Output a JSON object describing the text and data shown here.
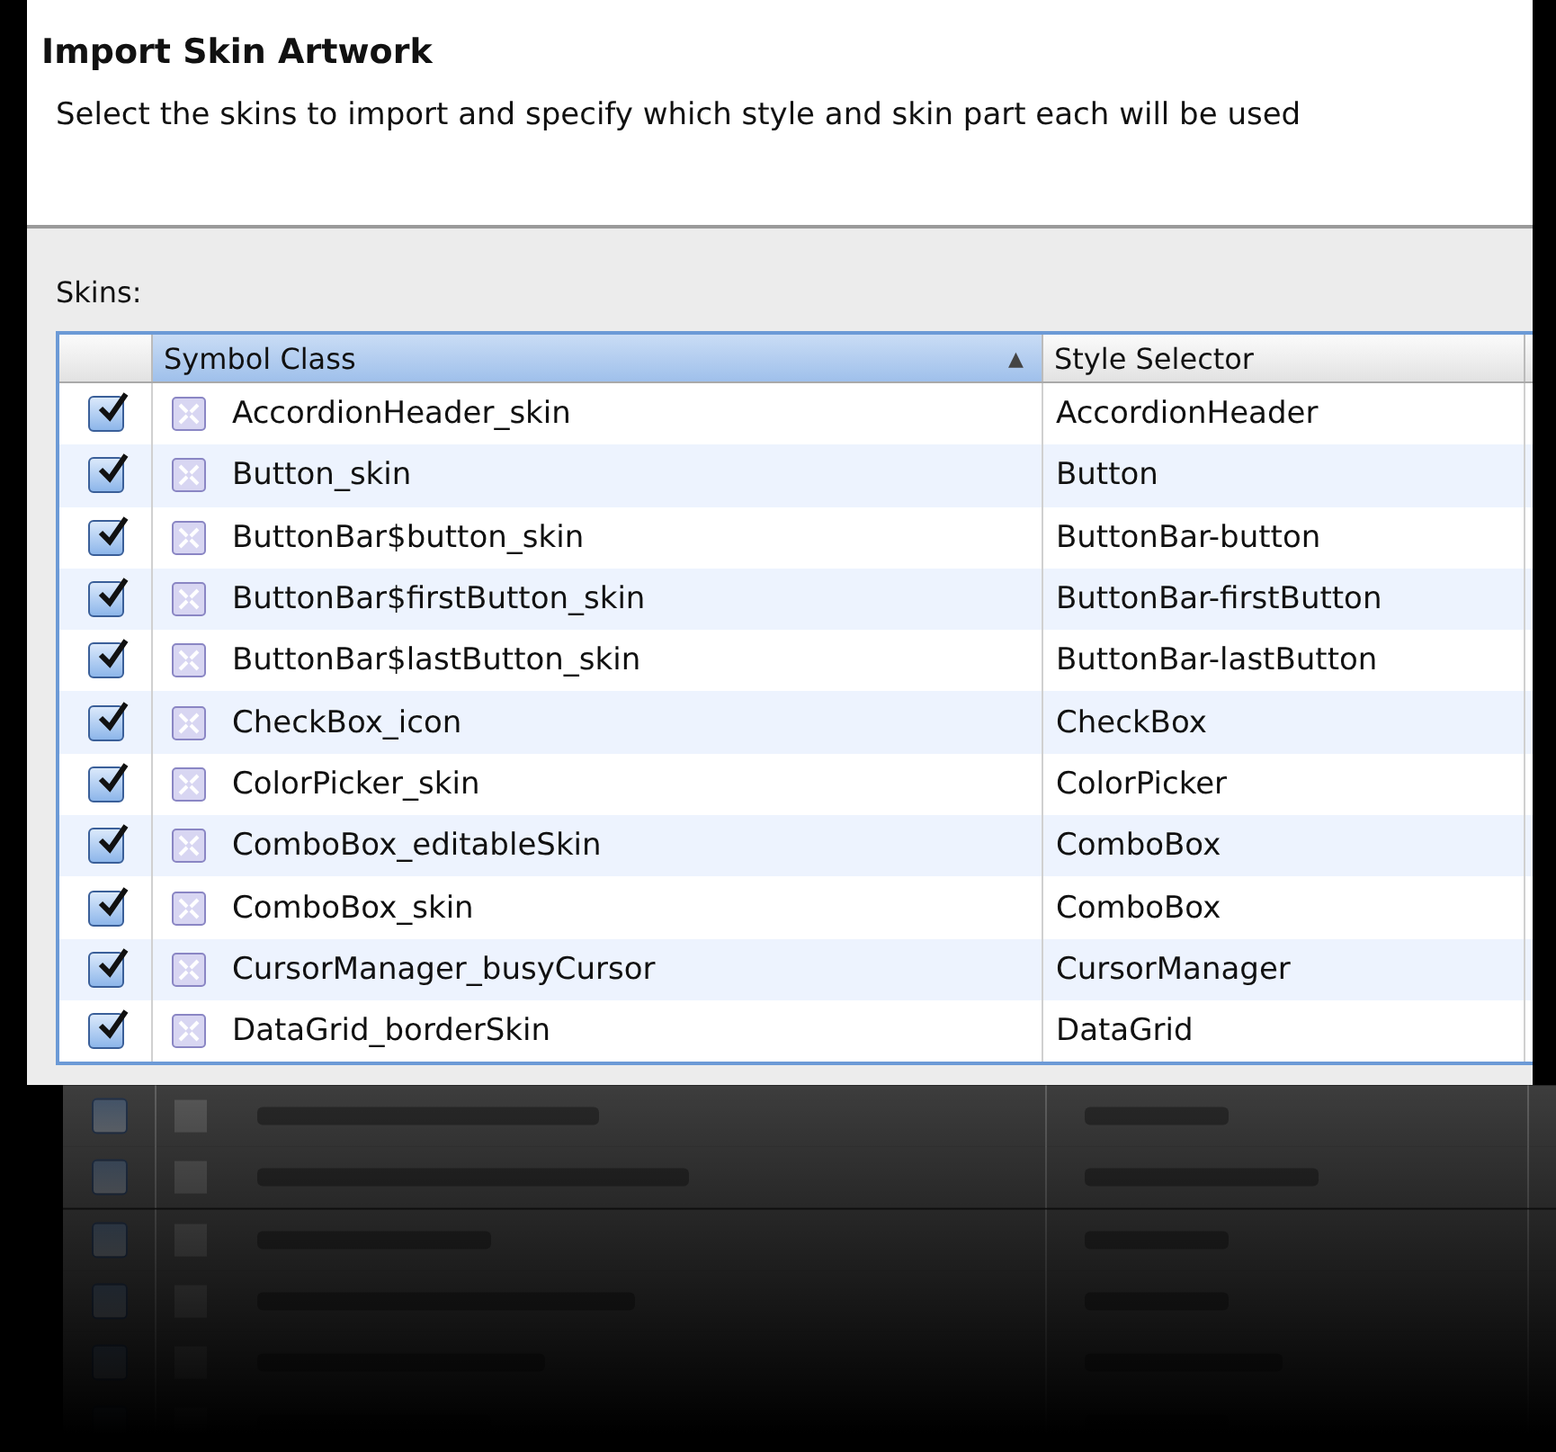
{
  "dialog": {
    "title": "Import Skin Artwork",
    "description": "Select the skins to import and specify which style and skin part each will be used"
  },
  "skins_label": "Skins:",
  "table": {
    "columns": [
      {
        "label": "Symbol Class",
        "selected": true,
        "sort_glyph": "▲"
      },
      {
        "label": "Style Selector",
        "selected": false
      }
    ],
    "rows": [
      {
        "checked": true,
        "symbol_class": "AccordionHeader_skin",
        "style_selector": "AccordionHeader"
      },
      {
        "checked": true,
        "symbol_class": "Button_skin",
        "style_selector": "Button"
      },
      {
        "checked": true,
        "symbol_class": "ButtonBar$button_skin",
        "style_selector": "ButtonBar-button"
      },
      {
        "checked": true,
        "symbol_class": "ButtonBar$firstButton_skin",
        "style_selector": "ButtonBar-firstButton"
      },
      {
        "checked": true,
        "symbol_class": "ButtonBar$lastButton_skin",
        "style_selector": "ButtonBar-lastButton"
      },
      {
        "checked": true,
        "symbol_class": "CheckBox_icon",
        "style_selector": "CheckBox"
      },
      {
        "checked": true,
        "symbol_class": "ColorPicker_skin",
        "style_selector": "ColorPicker"
      },
      {
        "checked": true,
        "symbol_class": "ComboBox_editableSkin",
        "style_selector": "ComboBox"
      },
      {
        "checked": true,
        "symbol_class": "ComboBox_skin",
        "style_selector": "ComboBox"
      },
      {
        "checked": true,
        "symbol_class": "CursorManager_busyCursor",
        "style_selector": "CursorManager"
      },
      {
        "checked": true,
        "symbol_class": "DataGrid_borderSkin",
        "style_selector": "DataGrid"
      }
    ]
  }
}
